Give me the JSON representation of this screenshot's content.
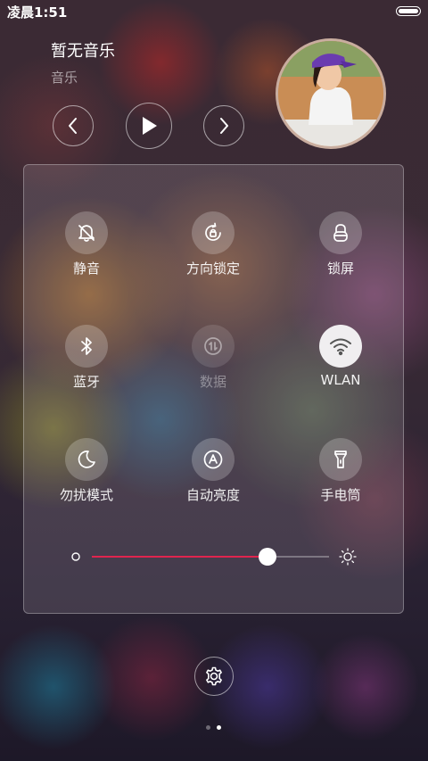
{
  "status_bar": {
    "time": "凌晨1:51",
    "battery_icon": "battery-icon"
  },
  "music": {
    "title": "暂无音乐",
    "subtitle": "音乐",
    "prev_icon": "chevron-left-icon",
    "play_icon": "play-icon",
    "next_icon": "chevron-right-icon"
  },
  "toggles": [
    {
      "label": "静音",
      "icon": "bell-off-icon",
      "state": "off"
    },
    {
      "label": "方向锁定",
      "icon": "rotation-lock-icon",
      "state": "off"
    },
    {
      "label": "锁屏",
      "icon": "lock-icon",
      "state": "off"
    },
    {
      "label": "蓝牙",
      "icon": "bluetooth-icon",
      "state": "off"
    },
    {
      "label": "数据",
      "icon": "mobile-data-icon",
      "state": "disabled"
    },
    {
      "label": "WLAN",
      "icon": "wifi-icon",
      "state": "on"
    },
    {
      "label": "勿扰模式",
      "icon": "moon-icon",
      "state": "off"
    },
    {
      "label": "自动亮度",
      "icon": "auto-brightness-icon",
      "state": "off"
    },
    {
      "label": "手电筒",
      "icon": "flashlight-icon",
      "state": "off"
    }
  ],
  "brightness": {
    "level": 0.74,
    "accent": "#e0244e"
  },
  "pager": {
    "count": 2,
    "active": 1
  }
}
